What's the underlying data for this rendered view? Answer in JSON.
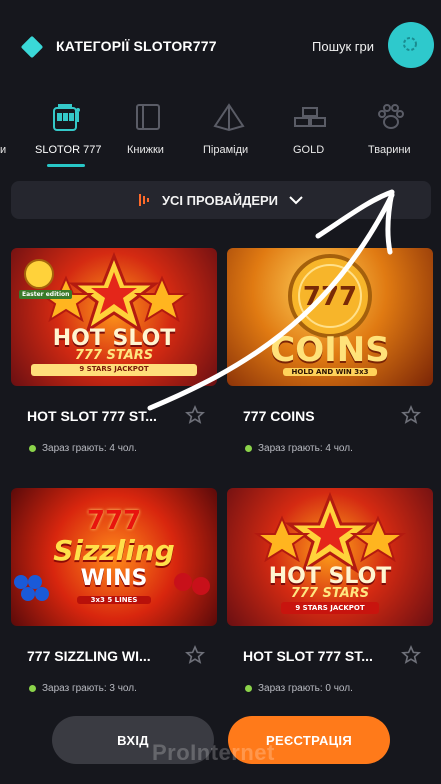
{
  "header": {
    "title": "КАТЕГОРІЇ SLOTOR777",
    "search_label": "Пошук гри",
    "logo_icon": "diamond-icon",
    "search_icon": "search-icon",
    "accent_color": "#2ec9cc"
  },
  "categories": [
    {
      "label": "и",
      "icon": "partial-icon",
      "active": false
    },
    {
      "label": "SLOTOR 777",
      "icon": "slot-machine-icon",
      "active": true
    },
    {
      "label": "Книжки",
      "icon": "book-icon",
      "active": false
    },
    {
      "label": "Піраміди",
      "icon": "pyramid-icon",
      "active": false
    },
    {
      "label": "GOLD",
      "icon": "gold-bars-icon",
      "active": false
    },
    {
      "label": "Тварини",
      "icon": "paw-icon",
      "active": false
    }
  ],
  "providers": {
    "label": "УСІ ПРОВАЙДЕРИ",
    "icon": "provider-icon",
    "chevron": "chevron-down-icon"
  },
  "games": [
    {
      "title": "HOT SLOT 777 ST...",
      "players": "Зараз грають: 4 чол.",
      "thumb_lines": [
        "HOT SLOT",
        "777 STARS",
        "9 STARS JACKPOT"
      ],
      "badge": "Easter edition"
    },
    {
      "title": "777 COINS",
      "players": "Зараз грають: 4 чол.",
      "thumb_lines": [
        "777",
        "COINS",
        "HOLD AND WIN 3x3"
      ]
    },
    {
      "title": "777 SIZZLING WI...",
      "players": "Зараз грають: 3 чол.",
      "thumb_lines": [
        "777",
        "Sizzling",
        "WINS",
        "3x3 5 LINES"
      ]
    },
    {
      "title": "HOT SLOT 777 ST...",
      "players": "Зараз грають: 0 чол.",
      "thumb_lines": [
        "HOT SLOT",
        "777 STARS",
        "9 STARS JACKPOT"
      ]
    }
  ],
  "buttons": {
    "login": "ВХІД",
    "register": "РЕЄСТРАЦІЯ",
    "register_color": "#ff7a1a"
  },
  "watermark": "ProInternet"
}
